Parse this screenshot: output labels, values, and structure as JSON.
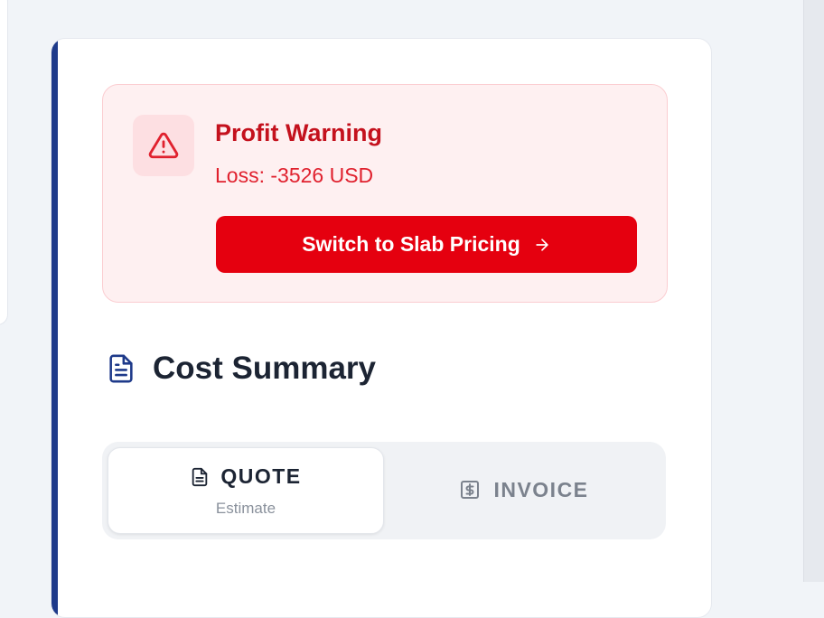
{
  "warning": {
    "title": "Profit Warning",
    "loss_text": "Loss: -3526 USD",
    "button_label": "Switch to Slab Pricing",
    "icon": "alert-triangle-icon",
    "button_icon": "arrow-right-icon"
  },
  "summary": {
    "title": "Cost Summary",
    "icon": "document-icon"
  },
  "tabs": [
    {
      "label": "QUOTE",
      "sublabel": "Estimate",
      "icon": "document-icon",
      "active": true
    },
    {
      "label": "INVOICE",
      "icon": "dollar-receipt-icon",
      "active": false
    }
  ],
  "colors": {
    "accent": "#1e3a8a",
    "danger": "#e5000f",
    "danger_text": "#c4111d",
    "warning_bg": "#fef0f1"
  }
}
